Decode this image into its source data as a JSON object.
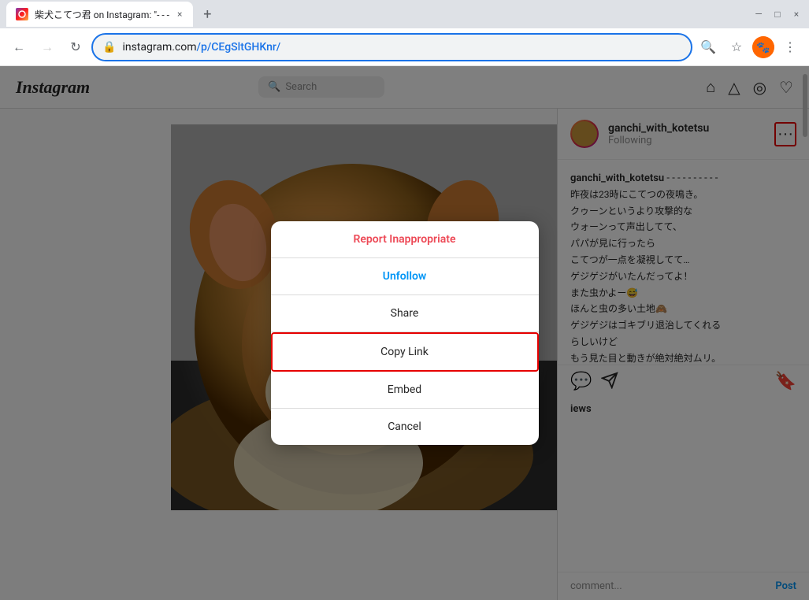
{
  "browser": {
    "tab": {
      "favicon": "instagram-icon",
      "title": "柴犬こてつ君 on Instagram: \"- - -",
      "close_label": "×"
    },
    "new_tab_label": "+",
    "window_controls": {
      "minimize": "—",
      "maximize": "□",
      "close": "×"
    },
    "nav": {
      "back_label": "←",
      "forward_label": "→",
      "refresh_label": "↻",
      "address": "instagram.com/p/CEgSltGHKnr/",
      "address_plain": "instagram.com",
      "address_path": "/p/CEgSltGHKnr/",
      "search_icon": "🔍",
      "star_icon": "☆",
      "menu_icon": "⋮"
    }
  },
  "instagram": {
    "logo": "Instagram",
    "search_placeholder": "Search",
    "header_icons": [
      "🏠",
      "▽",
      "◎",
      "♡"
    ],
    "post": {
      "username": "ganchi_with_kotetsu",
      "following_label": "Following",
      "more_icon": "···",
      "caption_username": "ganchi_with_kotetsu",
      "caption_dashes": "- - - - - - - - - -",
      "caption_text": "昨夜は23時にこてつの夜鳴き。\nクゥーンというより攻撃的な\nウォーンって声出してて、\nパパが見に行ったら\nこてつが一点を凝視してて…\nゲジゲジがいたんだってよ！\nまた虫かよー😅\nほんと虫の多い土地🙈\nゲジゲジはゴキブリ退治してくれる\nらしいけど\nもう見た目と動きが絶対絶対ムリ。\n\nパパが退治してからも\n神経過が過敏になっちゃったのか\nいつでも聞こえる外の虫の声にも\nビクビクして吠えてたけど\nすぐ落ち着いて寝てくれました🐈",
      "action_icons": {
        "comment": "💬",
        "share": "△",
        "bookmark": "🔖"
      },
      "views_text": "iews",
      "comment_placeholder": "comment...",
      "post_button": "Post"
    },
    "modal": {
      "items": [
        {
          "id": "report",
          "label": "Report Inappropriate",
          "type": "danger"
        },
        {
          "id": "unfollow",
          "label": "Unfollow",
          "type": "blue"
        },
        {
          "id": "share",
          "label": "Share",
          "type": "normal"
        },
        {
          "id": "copy-link",
          "label": "Copy Link",
          "type": "normal",
          "highlighted": true
        },
        {
          "id": "embed",
          "label": "Embed",
          "type": "normal"
        },
        {
          "id": "cancel",
          "label": "Cancel",
          "type": "normal"
        }
      ]
    }
  }
}
